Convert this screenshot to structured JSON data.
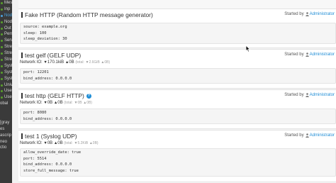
{
  "sidebar": {
    "items": [
      {
        "label": "Mes",
        "style": "green"
      },
      {
        "label": "Inp",
        "style": "green"
      },
      {
        "label": "Nod",
        "style": "active"
      },
      {
        "label": "Nod",
        "style": "green"
      },
      {
        "label": "Out",
        "style": "green"
      },
      {
        "label": "Perm",
        "style": "green"
      },
      {
        "label": "Serv",
        "style": "green"
      },
      {
        "label": "Stre",
        "style": "green"
      },
      {
        "label": "Stre",
        "style": "green"
      },
      {
        "label": "Stre",
        "style": "green"
      },
      {
        "label": "Syst",
        "style": "green"
      },
      {
        "label": "Syst",
        "style": "green"
      },
      {
        "label": "Syst",
        "style": "green"
      },
      {
        "label": "Univ",
        "style": "green"
      },
      {
        "label": "Use",
        "style": "green"
      },
      {
        "label": "Use",
        "style": "green"
      },
      {
        "label": "obal",
        "style": "plain"
      },
      {
        "label": "",
        "style": "plain"
      },
      {
        "label": "",
        "style": "plain"
      },
      {
        "label": "[gray",
        "style": "plain"
      },
      {
        "label": "es",
        "style": "plain"
      },
      {
        "label": "ascrip",
        "style": "plain"
      },
      {
        "label": "neo",
        "style": "plain"
      },
      {
        "label": "ctio",
        "style": "plain"
      },
      {
        "label": "",
        "style": "plain"
      },
      {
        "label": "",
        "style": "plain"
      },
      {
        "label": "",
        "style": "plain"
      },
      {
        "label": "",
        "style": "plain"
      },
      {
        "label": "",
        "style": "plain"
      }
    ]
  },
  "inputs": [
    {
      "title": "Fake HTTP (Random HTTP message generator)",
      "started_by_prefix": "Started by",
      "started_by_user": "Administrator",
      "has_help": false,
      "network_io": null,
      "config": [
        "source: example.org",
        "sleep: 100",
        "sleep_deviation: 30"
      ]
    },
    {
      "title": "test gelf (GELF UDP)",
      "started_by_prefix": "Started by",
      "started_by_user": "Administrator",
      "has_help": false,
      "network_io": {
        "label": "Network IO:",
        "rx": "170.1kiB",
        "tx": "0B",
        "total_label": "(total:",
        "total_rx": "2.6GiB",
        "total_tx": "0B)"
      },
      "config": [
        "port: 12201",
        "bind_address: 0.0.0.0"
      ]
    },
    {
      "title": "test http (GELF HTTP)",
      "started_by_prefix": "Started by",
      "started_by_user": "Administrator",
      "has_help": true,
      "help_glyph": "?",
      "network_io": {
        "label": "Network IO:",
        "rx": "0B",
        "tx": "0B",
        "total_label": "(total:",
        "total_rx": "0B",
        "total_tx": "0B)"
      },
      "config": [
        "port: 8080",
        "bind_address: 0.0.0.0"
      ]
    },
    {
      "title": "test 1 (Syslog UDP)",
      "started_by_prefix": "Started by",
      "started_by_user": "Administrator",
      "has_help": false,
      "network_io": {
        "label": "Network IO:",
        "rx": "0B",
        "tx": "0B",
        "total_label": "(total:",
        "total_rx": "5.2KiB",
        "total_tx": "0B)"
      },
      "config": [
        "allow_override_date: true",
        "port: 5514",
        "bind_address: 0.0.0.0",
        "store_full_message: true"
      ]
    }
  ],
  "icons": {
    "rx": "arrow-down-icon",
    "tx": "arrow-up-icon",
    "user": "user-icon",
    "help": "help-icon",
    "cursor": "mouse-cursor-icon"
  },
  "colors": {
    "link": "#1f8dd6",
    "sidebar_bg": "#3a3a3a",
    "sidebar_dot": "#5aa02c",
    "active": "#4ba3e0"
  }
}
